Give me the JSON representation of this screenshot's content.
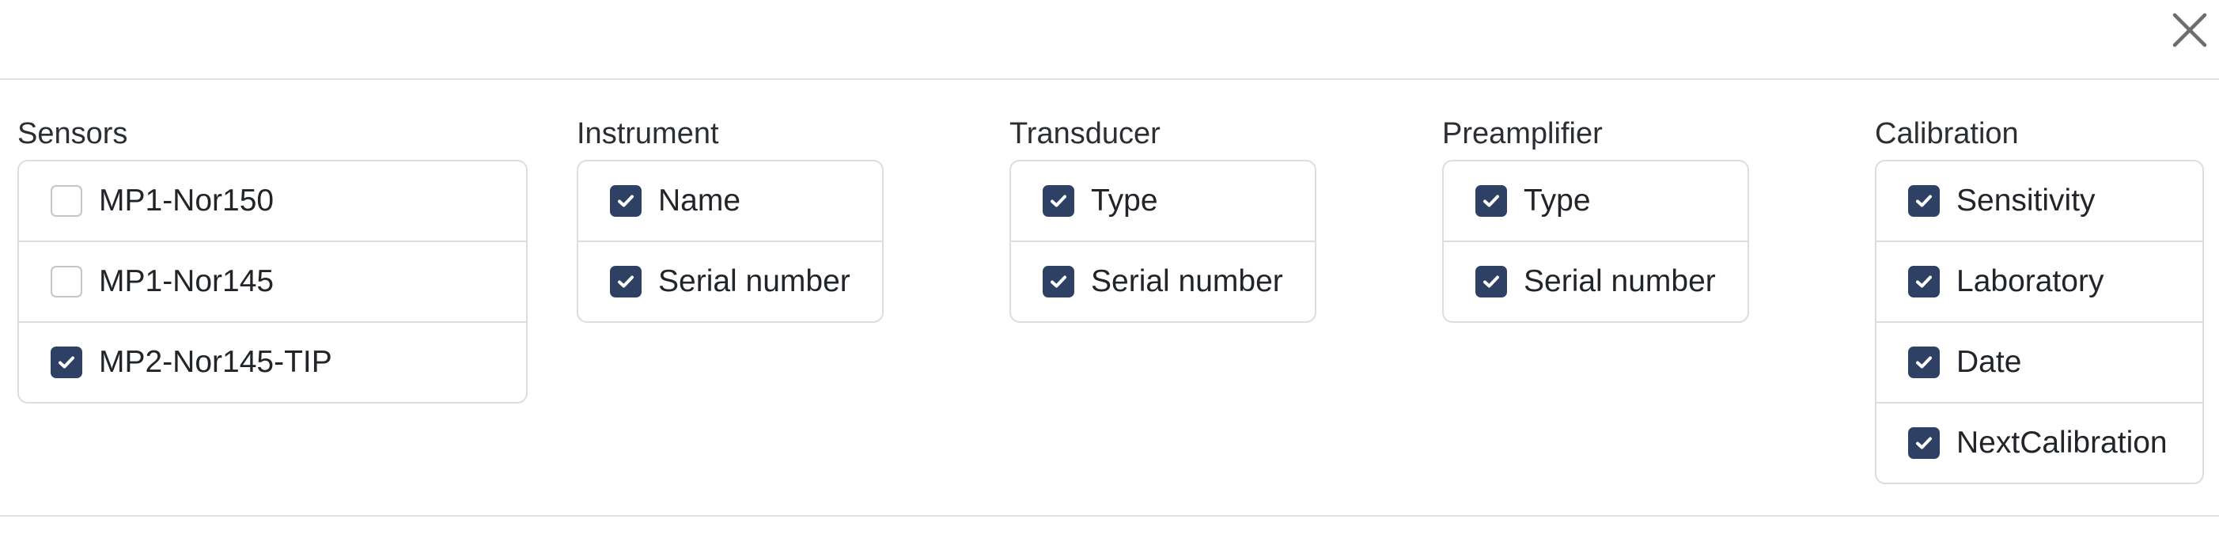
{
  "header": {
    "close_icon": "close-icon (×)"
  },
  "colors": {
    "checkbox_checked": "#2e4164",
    "checkbox_unchecked_border": "#c6c6c6",
    "divider": "#dee2e6",
    "list_border": "#dddddd",
    "text": "#212529"
  },
  "groups": [
    {
      "title": "Sensors",
      "items": [
        {
          "label": "MP1-Nor150",
          "checked": false
        },
        {
          "label": "MP1-Nor145",
          "checked": false
        },
        {
          "label": "MP2-Nor145-TIP",
          "checked": true
        }
      ]
    },
    {
      "title": "Instrument",
      "items": [
        {
          "label": "Name",
          "checked": true
        },
        {
          "label": "Serial number",
          "checked": true
        }
      ]
    },
    {
      "title": "Transducer",
      "items": [
        {
          "label": "Type",
          "checked": true
        },
        {
          "label": "Serial number",
          "checked": true
        }
      ]
    },
    {
      "title": "Preamplifier",
      "items": [
        {
          "label": "Type",
          "checked": true
        },
        {
          "label": "Serial number",
          "checked": true
        }
      ]
    },
    {
      "title": "Calibration",
      "items": [
        {
          "label": "Sensitivity",
          "checked": true
        },
        {
          "label": "Laboratory",
          "checked": true
        },
        {
          "label": "Date",
          "checked": true
        },
        {
          "label": "NextCalibration",
          "checked": true
        }
      ]
    }
  ]
}
